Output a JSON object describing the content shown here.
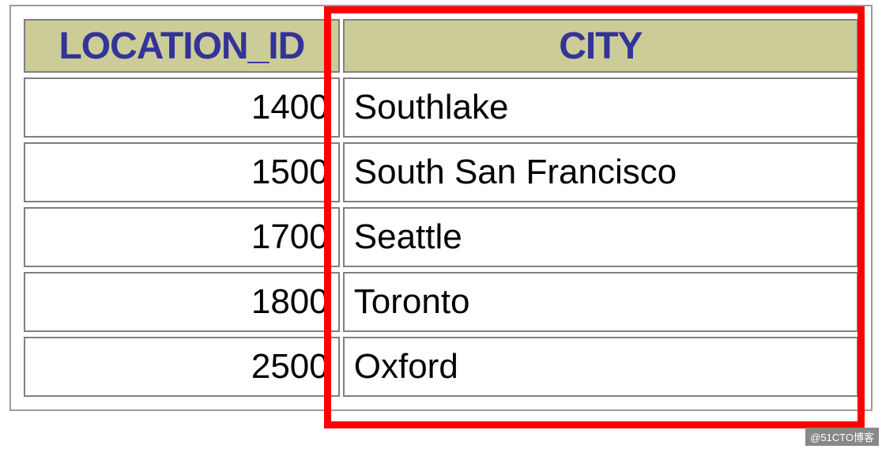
{
  "chart_data": {
    "type": "table",
    "columns": [
      "LOCATION_ID",
      "CITY"
    ],
    "rows": [
      {
        "LOCATION_ID": 1400,
        "CITY": "Southlake"
      },
      {
        "LOCATION_ID": 1500,
        "CITY": "South San Francisco"
      },
      {
        "LOCATION_ID": 1700,
        "CITY": "Seattle"
      },
      {
        "LOCATION_ID": 1800,
        "CITY": "Toronto"
      },
      {
        "LOCATION_ID": 2500,
        "CITY": "Oxford"
      }
    ],
    "highlighted_column": "CITY"
  },
  "table": {
    "headers": {
      "col0": "LOCATION_ID",
      "col1": "CITY"
    },
    "rows": [
      {
        "id": "1400",
        "city": "Southlake"
      },
      {
        "id": "1500",
        "city": "South San Francisco"
      },
      {
        "id": "1700",
        "city": "Seattle"
      },
      {
        "id": "1800",
        "city": "Toronto"
      },
      {
        "id": "2500",
        "city": "Oxford"
      }
    ]
  },
  "watermark": "@51CTO博客"
}
